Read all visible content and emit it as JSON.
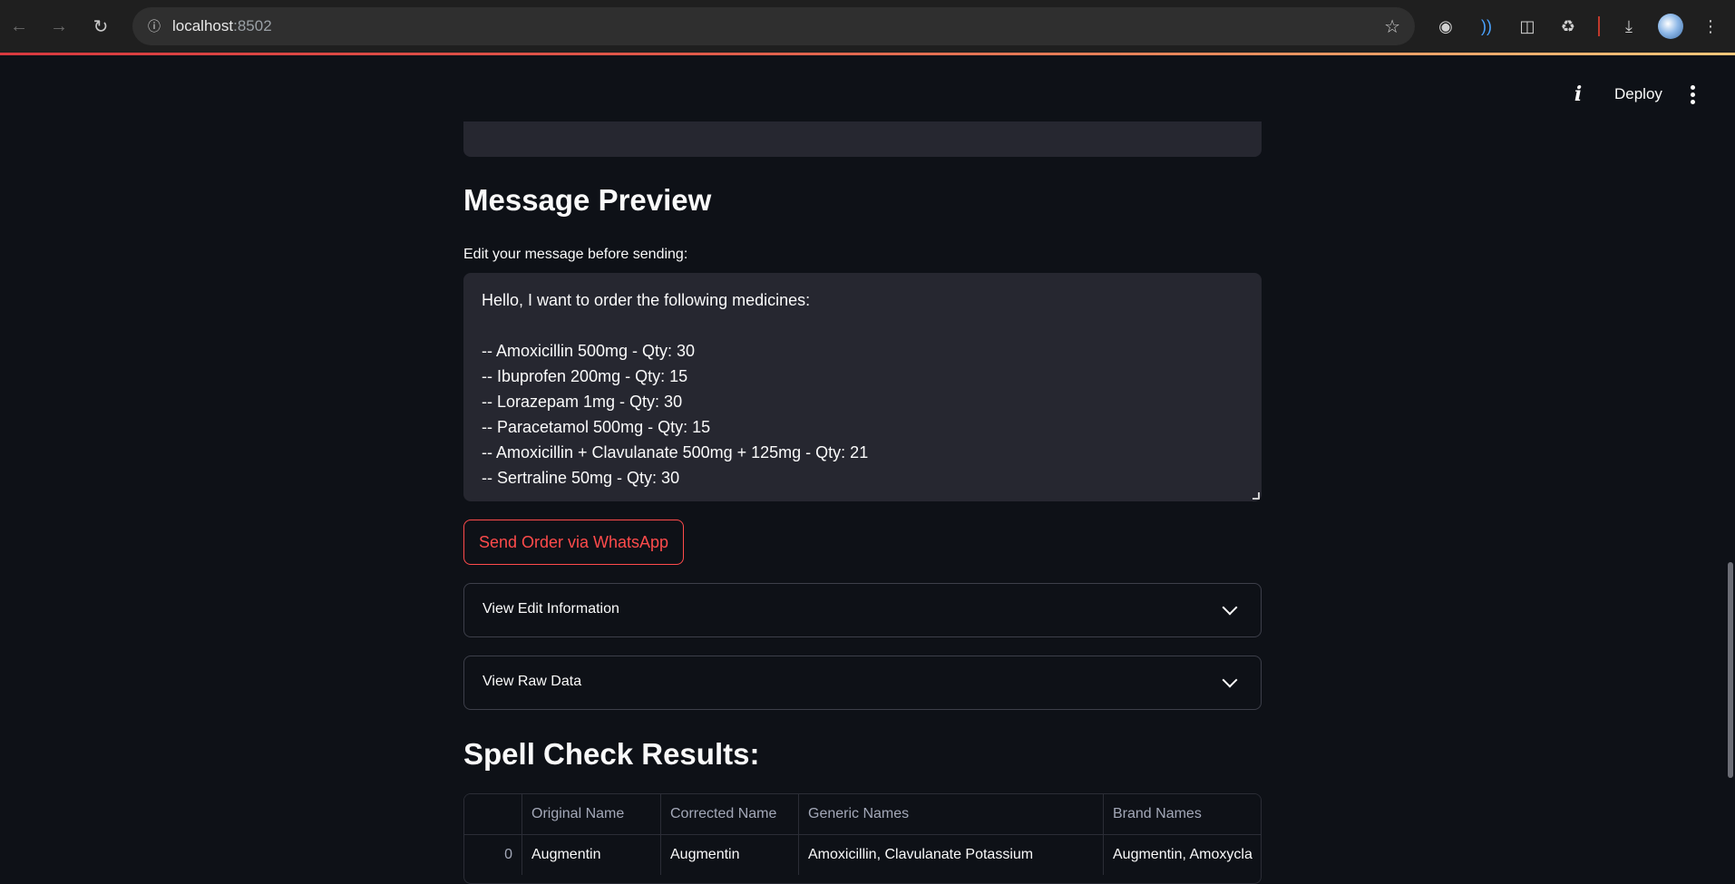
{
  "browser": {
    "url_host": "localhost",
    "url_port": ":8502"
  },
  "header": {
    "deploy_label": "Deploy"
  },
  "main": {
    "preview_heading": "Message Preview",
    "message_label": "Edit your message before sending:",
    "message_lines": [
      "Hello, I want to order the following medicines:",
      "",
      "-- Amoxicillin 500mg - Qty: 30",
      "-- Ibuprofen 200mg - Qty: 15",
      "-- Lorazepam 1mg - Qty: 30",
      "-- Paracetamol 500mg - Qty: 15",
      "-- Amoxicillin + Clavulanate 500mg + 125mg - Qty: 21",
      "-- Sertraline 50mg - Qty: 30"
    ],
    "send_button_label": "Send Order via WhatsApp",
    "expanders": [
      {
        "label": "View Edit Information"
      },
      {
        "label": "View Raw Data"
      }
    ],
    "spell_heading": "Spell Check Results:",
    "table": {
      "columns": [
        "",
        "Original Name",
        "Corrected Name",
        "Generic Names",
        "Brand Names"
      ],
      "rows": [
        [
          "0",
          "Augmentin",
          "Augmentin",
          "Amoxicillin, Clavulanate Potassium",
          "Augmentin, Amoxycla"
        ]
      ]
    }
  },
  "colors": {
    "background": "#0e1117",
    "input_background": "#262730",
    "accent": "#ff4b4b"
  }
}
